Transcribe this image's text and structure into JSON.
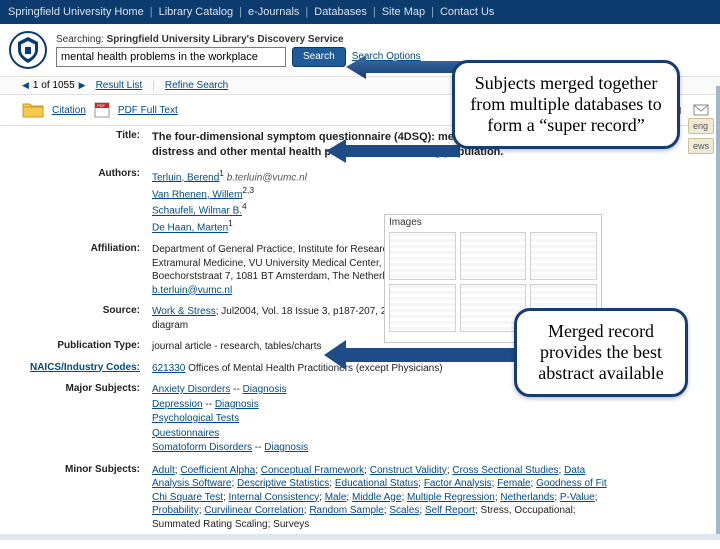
{
  "topnav": {
    "home": "Springfield University Home",
    "catalog": "Library Catalog",
    "ejournals": "e-Journals",
    "databases": "Databases",
    "sitemap": "Site Map",
    "contact": "Contact Us"
  },
  "search": {
    "label_prefix": "Searching:",
    "label_service": "Springfield University Library's Discovery Service",
    "value": "mental health problems in the workplace",
    "button": "Search",
    "options": "Search Options"
  },
  "pager": {
    "pos": "1 of 1055",
    "resultlist": "Result List",
    "refine": "Refine Search"
  },
  "actions": {
    "citation": "Citation",
    "pdf": "PDF Full Text"
  },
  "rightchips": {
    "a": "eng",
    "b": "ews"
  },
  "record": {
    "labels": {
      "title": "Title:",
      "authors": "Authors:",
      "affiliation": "Affiliation:",
      "source": "Source:",
      "pubtype": "Publication Type:",
      "naics": "NAICS/Industry Codes:",
      "majors": "Major Subjects:",
      "minors": "Minor Subjects:"
    },
    "title": "The four-dimensional symptom questionnaire (4DSQ): measuring distress and other mental health problems in a working population.",
    "authors": {
      "a1": "Terluin, Berend",
      "a1_sup": "1",
      "a1_email": "b.terluin@vumc.nl",
      "a2": "Van Rhenen, Willem",
      "a2_sup": "2,3",
      "a3": "Schaufeli, Wilmar B.",
      "a3_sup": "4",
      "a4": "De Haan, Marten",
      "a4_sup": "1"
    },
    "affiliation": "Department of General Practice, Institute for Research in Extramural Medicine, VU University Medical Center, Van der Boechorststraat 7, 1081 BT Amsterdam, The Netherlands, ",
    "affiliation_email": "b.terluin@vumc.nl",
    "source_link": "Work & Stress",
    "source_rest": "; Jul2004, Vol. 18 Issue 3, p187-207, 21p, 5 charts, 1 diagram",
    "pubtype": "journal article - research, tables/charts",
    "naics_code": "621330",
    "naics_text": " Offices of Mental Health Practitioners (except Physicians)",
    "majors": [
      [
        "Anxiety Disorders",
        "Diagnosis"
      ],
      [
        "Depression",
        "Diagnosis"
      ],
      [
        "Psychological Tests"
      ],
      [
        "Questionnaires"
      ],
      [
        "Somatoform Disorders",
        "Diagnosis"
      ]
    ],
    "minors_links": "Adult; Coefficient Alpha; Conceptual Framework; Construct Validity; Cross Sectional Studies; Data Analysis Software; Descriptive Statistics; Educational Status; Factor Analysis; Female; Goodness of Fit Chi Square Test; Internal Consistency; Male; Middle Age; Multiple Regression; Netherlands; P-Value; Probability; Curvilinear Correlation; Random Sample; Scales; Self Report",
    "minors_plain": "; Stress, Occupational; Summated Rating Scaling; Surveys"
  },
  "images_panel": {
    "header": "Images"
  },
  "callouts": {
    "top": "Subjects merged together from multiple databases to form a “super record”",
    "bottom": "Merged record provides the best abstract available"
  }
}
